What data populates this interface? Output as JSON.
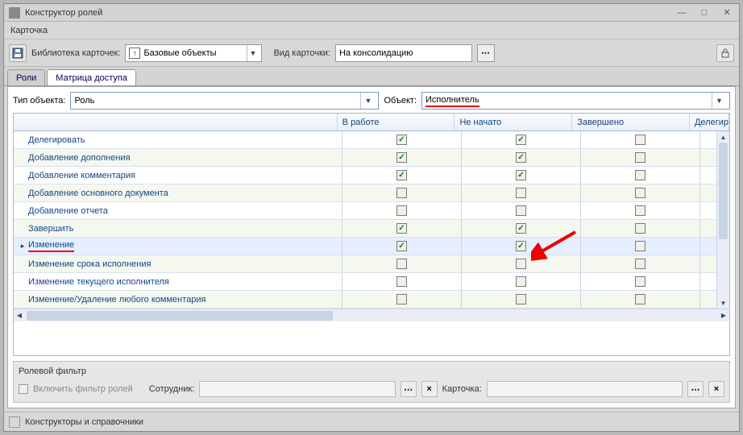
{
  "window": {
    "title": "Конструктор ролей"
  },
  "menu": {
    "card": "Карточка"
  },
  "toolbar": {
    "library_label": "Библиотека карточек:",
    "library_value": "Базовые объекты",
    "cardtype_label": "Вид карточки:",
    "cardtype_value": "На консолидацию"
  },
  "tabs": {
    "roles": "Роли",
    "matrix": "Матрица доступа"
  },
  "filters_top": {
    "objtype_label": "Тип объекта:",
    "objtype_value": "Роль",
    "object_label": "Объект:",
    "object_value": "Исполнитель"
  },
  "columns": {
    "c1": "В работе",
    "c2": "Не начато",
    "c3": "Завершено",
    "c4": "Делегир"
  },
  "rows": [
    {
      "name": "Делегировать",
      "v": [
        true,
        true,
        false
      ],
      "underline": false,
      "pointer": false
    },
    {
      "name": "Добавление дополнения",
      "v": [
        true,
        true,
        false
      ],
      "underline": false,
      "pointer": false
    },
    {
      "name": "Добавление комментария",
      "v": [
        true,
        true,
        false
      ],
      "underline": false,
      "pointer": false
    },
    {
      "name": "Добавление основного документа",
      "v": [
        false,
        false,
        false
      ],
      "underline": false,
      "pointer": false
    },
    {
      "name": "Добавление отчета",
      "v": [
        false,
        false,
        false
      ],
      "underline": false,
      "pointer": false
    },
    {
      "name": "Завершить",
      "v": [
        true,
        true,
        false
      ],
      "underline": false,
      "pointer": false
    },
    {
      "name": "Изменение",
      "v": [
        true,
        true,
        false
      ],
      "underline": true,
      "pointer": true
    },
    {
      "name": "Изменение срока исполнения",
      "v": [
        false,
        false,
        false
      ],
      "underline": false,
      "pointer": false
    },
    {
      "name": "Изменение текущего исполнителя",
      "v": [
        false,
        false,
        false
      ],
      "underline": false,
      "pointer": false
    },
    {
      "name": "Изменение/Удаление любого комментария",
      "v": [
        false,
        false,
        false
      ],
      "underline": false,
      "pointer": false
    }
  ],
  "filterbox": {
    "heading": "Ролевой фильтр",
    "enable_label": "Включить фильтр ролей",
    "employee_label": "Сотрудник:",
    "card_label": "Карточка:"
  },
  "statusbar": {
    "text": "Конструкторы и справочники"
  }
}
